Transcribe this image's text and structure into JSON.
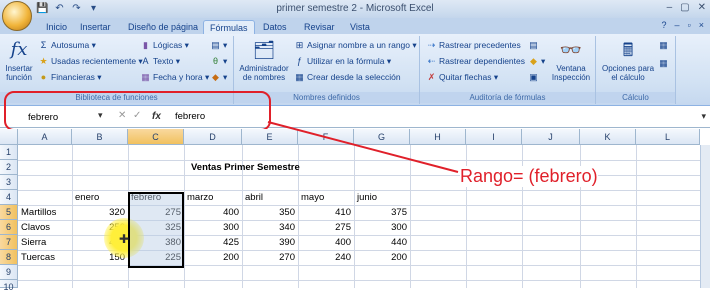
{
  "window": {
    "title": "primer semestre 2 - Microsoft Excel",
    "controls": [
      "–",
      "▢",
      "✕"
    ]
  },
  "qat_icons": [
    "save-icon",
    "undo-icon",
    "redo-icon",
    "dropdown-icon"
  ],
  "tabs": [
    "Inicio",
    "Insertar",
    "Diseño de página",
    "Fórmulas",
    "Datos",
    "Revisar",
    "Vista"
  ],
  "active_tab": "Fórmulas",
  "ribbon": {
    "insert_function": "Insertar función",
    "library": {
      "label": "Biblioteca de funciones",
      "autosum": "Autosuma",
      "recent": "Usadas recientemente",
      "financial": "Financieras",
      "logical": "Lógicas",
      "text": "Texto",
      "datetime": "Fecha y hora"
    },
    "names": {
      "label": "Nombres definidos",
      "manager": "Administrador de nombres",
      "assign": "Asignar nombre a un rango",
      "use_in_formula": "Utilizar en la fórmula",
      "create_from_selection": "Crear desde la selección"
    },
    "audit": {
      "label": "Auditoría de fórmulas",
      "trace_precedents": "Rastrear precedentes",
      "trace_dependents": "Rastrear dependientes",
      "remove_arrows": "Quitar flechas",
      "watch_window": "Ventana Inspección"
    },
    "calc": {
      "label": "Cálculo",
      "options": "Opciones para el cálculo"
    }
  },
  "formula_bar": {
    "name_box": "febrero",
    "fx": "fx",
    "content": "febrero"
  },
  "columns": [
    "A",
    "B",
    "C",
    "D",
    "E",
    "F",
    "G",
    "H",
    "I",
    "J",
    "K",
    "L"
  ],
  "rows": [
    "1",
    "2",
    "3",
    "4",
    "5",
    "6",
    "7",
    "8",
    "9",
    "10"
  ],
  "sheet": {
    "title": "Ventas Primer Semestre",
    "headers": [
      "enero",
      "febrero",
      "marzo",
      "abril",
      "mayo",
      "junio"
    ],
    "data": [
      {
        "name": "Martillos",
        "values": [
          "320",
          "275",
          "400",
          "350",
          "410",
          "375"
        ]
      },
      {
        "name": "Clavos",
        "values": [
          "250",
          "325",
          "300",
          "340",
          "275",
          "300"
        ]
      },
      {
        "name": "Sierra",
        "values": [
          "400",
          "380",
          "425",
          "390",
          "400",
          "440"
        ]
      },
      {
        "name": "Tuercas",
        "values": [
          "150",
          "225",
          "200",
          "270",
          "240",
          "200"
        ]
      }
    ]
  },
  "annotation": "Rango= (febrero)",
  "colors": {
    "annotation": "#e0202a",
    "ribbon": "#d1e1f3",
    "selection": "#f1c15f"
  }
}
